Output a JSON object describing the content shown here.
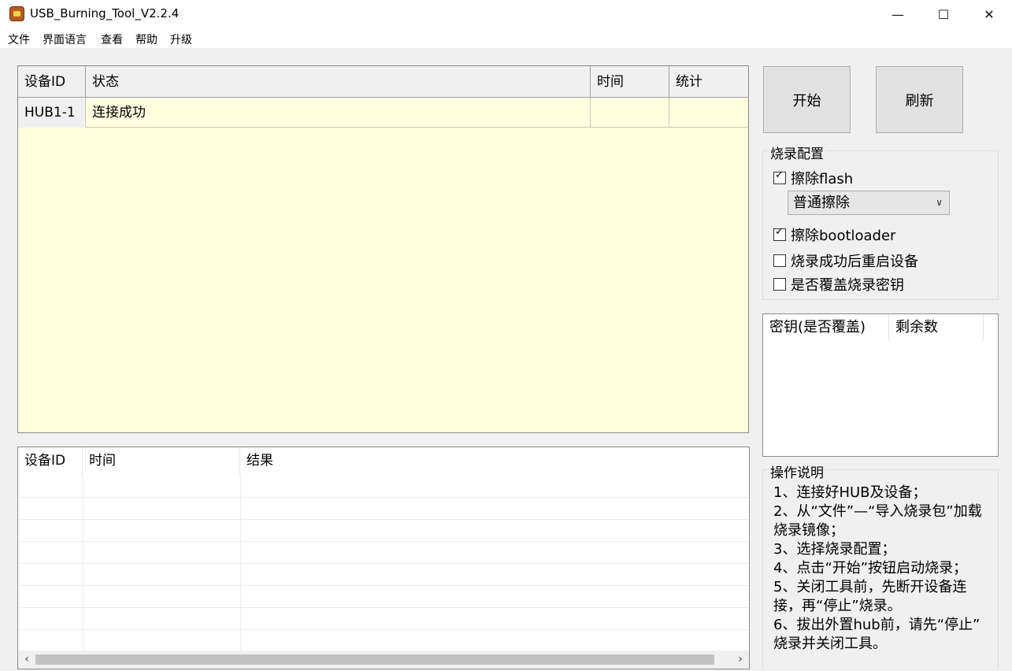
{
  "window": {
    "title": "USB_Burning_Tool_V2.2.4",
    "controls": {
      "minimize": "—",
      "maximize": "☐",
      "close": "✕"
    }
  },
  "menu": [
    "文件",
    "界面语言",
    "查看",
    "帮助",
    "升级"
  ],
  "device_table": {
    "columns": [
      "设备ID",
      "状态",
      "时间",
      "统计"
    ],
    "rows": [
      {
        "device_id": "HUB1-1",
        "status": "连接成功",
        "time": "",
        "stat": ""
      }
    ],
    "background": "#ffffe0"
  },
  "log_table": {
    "columns": [
      "设备ID",
      "时间",
      "结果"
    ],
    "rows": []
  },
  "buttons": {
    "start": "开始",
    "refresh": "刷新"
  },
  "burn_config": {
    "title": "烧录配置",
    "erase_flash": {
      "label": "擦除flash",
      "checked": true
    },
    "erase_mode": "普通擦除",
    "erase_bootloader": {
      "label": "擦除bootloader",
      "checked": true
    },
    "reboot_after_success": {
      "label": "烧录成功后重启设备",
      "checked": false
    },
    "overwrite_key": {
      "label": "是否覆盖烧录密钥",
      "checked": false
    }
  },
  "key_table": {
    "columns": [
      "密钥(是否覆盖)",
      "剩余数"
    ]
  },
  "instructions": {
    "title": "操作说明",
    "lines": [
      "1、连接好HUB及设备；",
      "2、从“文件”—“导入烧录包”加载",
      "烧录镜像；",
      "3、选择烧录配置；",
      "4、点击“开始”按钮启动烧录；",
      "5、关闭工具前，先断开设备连",
      "接，再“停止”烧录。",
      "6、拔出外置hub前，请先“停止”",
      "烧录并关闭工具。"
    ]
  },
  "icons": {
    "app": "app-icon",
    "dropdown": "chevron-down-icon",
    "scroll_left": "chevron-left-icon",
    "scroll_right": "chevron-right-icon"
  }
}
